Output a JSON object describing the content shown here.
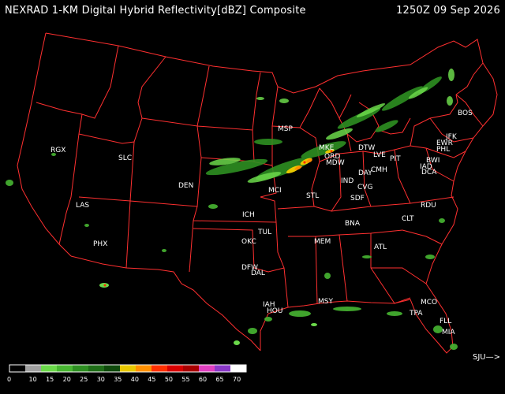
{
  "header": {
    "title": "NEXRAD 1-KM Digital Hybrid Reflectivity[dBZ] Composite",
    "timestamp": "1250Z 09 Sep 2026"
  },
  "colors": {
    "background": "#000000",
    "boundaries": "#ff3030",
    "labels": "#ffffff"
  },
  "stations": [
    "RGX",
    "SLC",
    "DEN",
    "LAS",
    "PHX",
    "ICH",
    "OKC",
    "TUL",
    "DFW",
    "DAL",
    "IAH",
    "HOU",
    "MSY",
    "MEM",
    "BNA",
    "ATL",
    "MCO",
    "TPA",
    "FLL",
    "MIA",
    "STL",
    "MCI",
    "ORD",
    "MDW",
    "MKE",
    "MSP",
    "DTW",
    "LVE",
    "PIT",
    "CMH",
    "DAY",
    "CVG",
    "SDF",
    "IND",
    "CLT",
    "RDU",
    "EWR",
    "JFK",
    "PHL",
    "BWI",
    "IAD",
    "DCA",
    "BOS"
  ],
  "legend": {
    "ticks": [
      "0",
      "10",
      "15",
      "20",
      "25",
      "30",
      "35",
      "40",
      "45",
      "50",
      "55",
      "60",
      "65",
      "70"
    ],
    "colors": [
      "#000000",
      "#a0a0a0",
      "#6bd94a",
      "#48b632",
      "#2e8f22",
      "#1f6e18",
      "#0f4a0c",
      "#e8c800",
      "#ff9000",
      "#ff3000",
      "#d80000",
      "#a80000",
      "#e040c0",
      "#8a38c8",
      "#ffffff"
    ]
  },
  "signature": "SJU—>"
}
